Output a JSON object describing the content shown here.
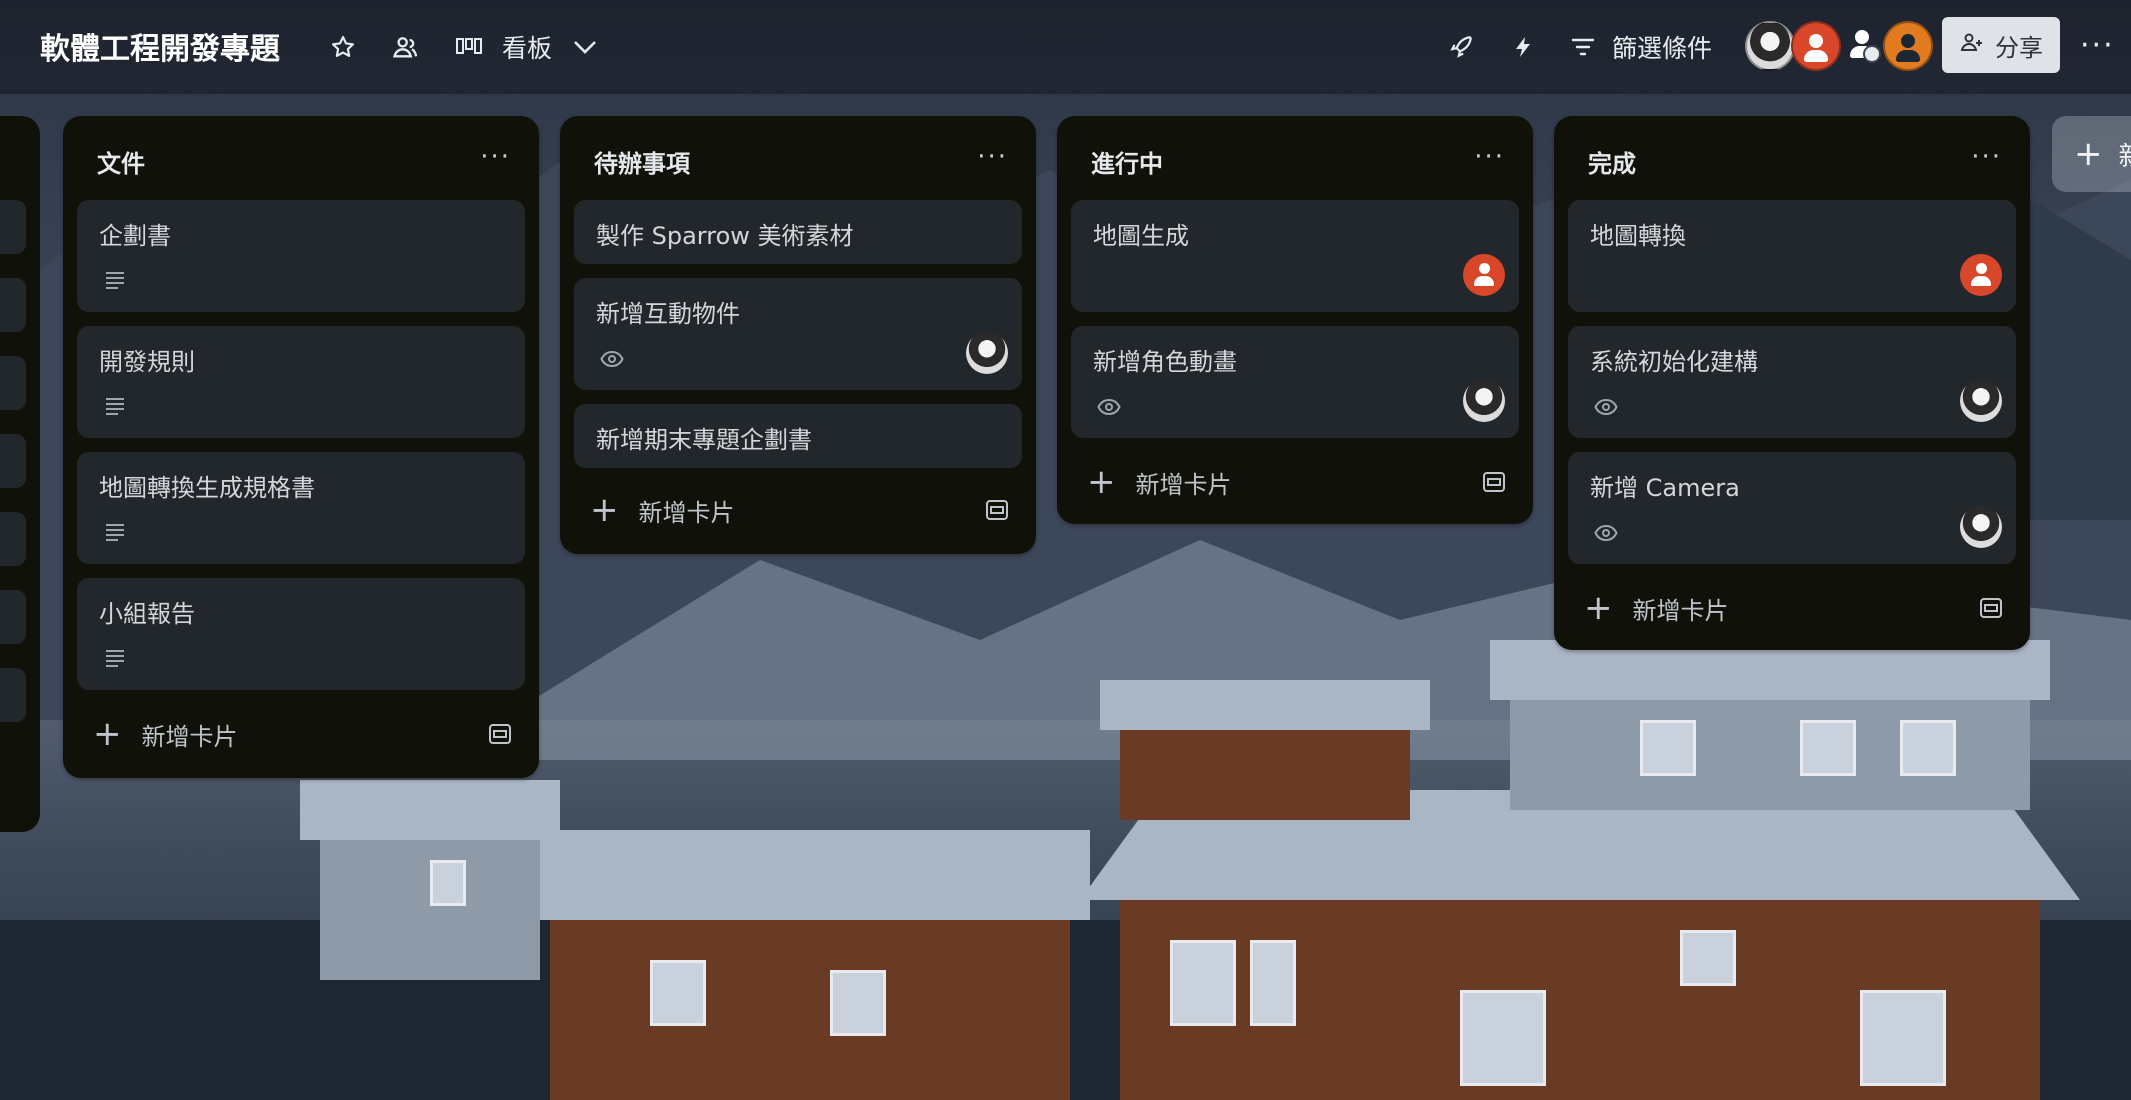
{
  "header": {
    "board_title": "軟體工程開發專題",
    "view_label": "看板",
    "filter_label": "篩選條件",
    "share_label": "分享",
    "more_label": "···"
  },
  "lists": [
    {
      "title": "文件",
      "cards": [
        {
          "title": "企劃書",
          "badge": "description-icon"
        },
        {
          "title": "開發規則",
          "badge": "description-icon"
        },
        {
          "title": "地圖轉換生成規格書",
          "badge": "description-icon"
        },
        {
          "title": "小組報告",
          "badge": "description-icon"
        }
      ],
      "add_label": "新增卡片"
    },
    {
      "title": "待辦事項",
      "cards": [
        {
          "title": "製作 Sparrow 美術素材"
        },
        {
          "title": "新增互動物件",
          "badge": "watch-icon",
          "member": "anime"
        },
        {
          "title": "新增期末專題企劃書"
        }
      ],
      "add_label": "新增卡片"
    },
    {
      "title": "進行中",
      "cards": [
        {
          "title": "地圖生成",
          "member": "red"
        },
        {
          "title": "新增角色動畫",
          "badge": "watch-icon",
          "member": "anime"
        }
      ],
      "add_label": "新增卡片"
    },
    {
      "title": "完成",
      "cards": [
        {
          "title": "地圖轉換",
          "member": "red"
        },
        {
          "title": "系統初始化建構",
          "badge": "watch-icon",
          "member": "anime"
        },
        {
          "title": "新增 Camera",
          "badge": "watch-icon",
          "member": "anime"
        }
      ],
      "add_label": "新增卡片"
    }
  ],
  "add_list_label": "新",
  "colors": {
    "list_bg": "#101209",
    "card_bg": "#22272b",
    "member_red": "#d9472b",
    "member_orange": "#e27b1f"
  }
}
